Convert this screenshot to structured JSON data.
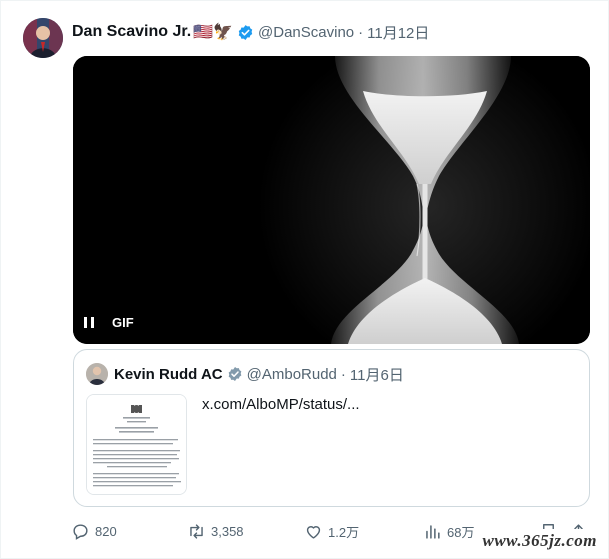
{
  "tweet": {
    "author_name": "Dan Scavino Jr.",
    "author_emoji": "🇺🇸🦅",
    "handle": "@DanScavino",
    "separator": "·",
    "time": "11月12日",
    "media_badge": "GIF",
    "media_description": "hourglass"
  },
  "quote": {
    "author_name": "Kevin Rudd AC",
    "handle": "@AmboRudd",
    "separator": "·",
    "time": "11月6日",
    "link_text": "x.com/AlboMP/status/...",
    "thumb_lines": [
      "Embassy of Australia",
      "Washington",
      "Ambassador to the United States",
      "The Hon. Dr Kevin Rudd AC"
    ]
  },
  "actions": {
    "reply_count": "820",
    "retweet_count": "3,358",
    "like_count": "1.2万",
    "view_count": "68万"
  },
  "watermark": "www.365jz.com",
  "colors": {
    "verified": "#1d9bf0",
    "secondary_text": "#536471",
    "primary_text": "#0f1419",
    "border": "#cfd9de"
  }
}
